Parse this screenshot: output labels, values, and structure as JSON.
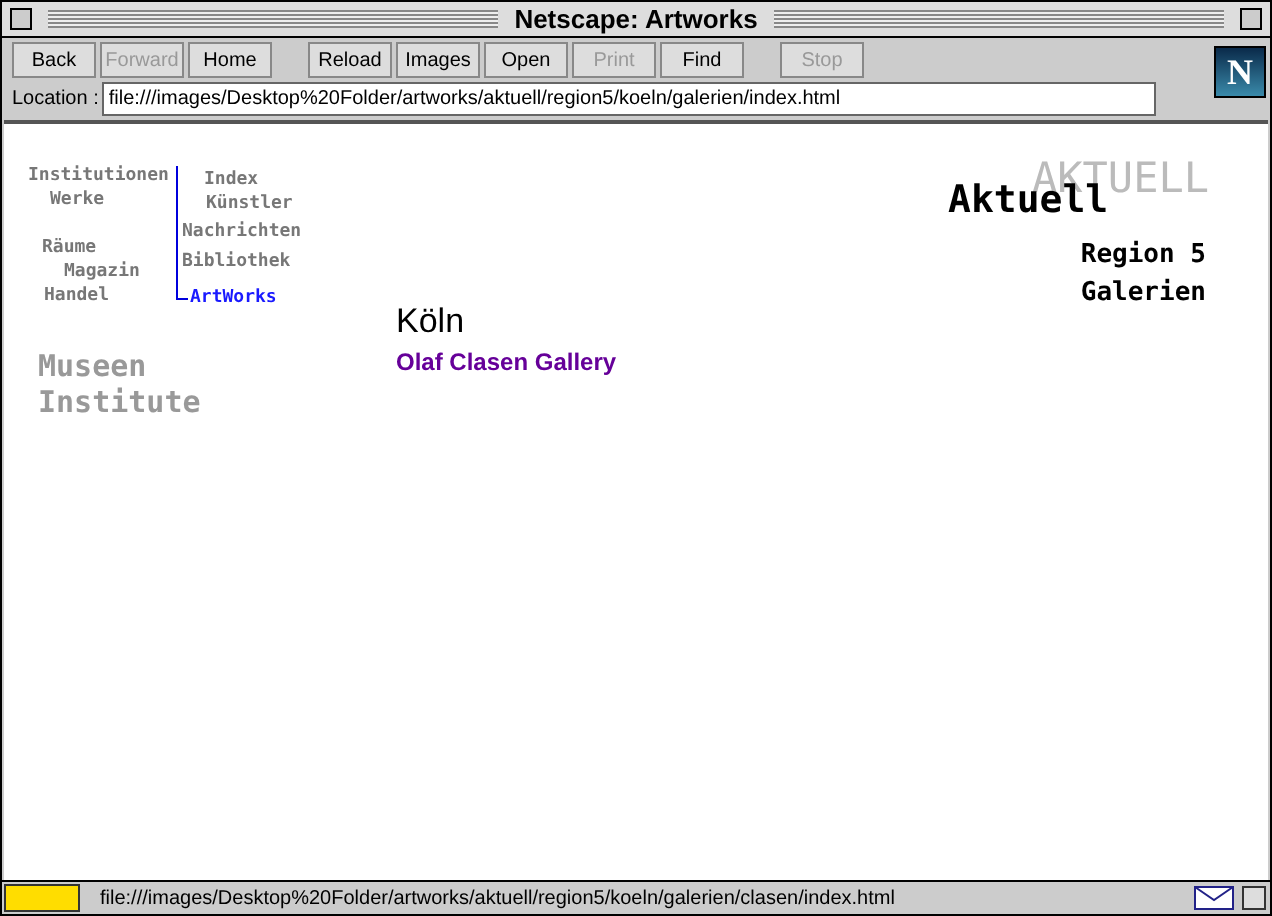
{
  "window": {
    "title": "Netscape: Artworks"
  },
  "toolbar": [
    {
      "label": "Back",
      "disabled": false
    },
    {
      "label": "Forward",
      "disabled": true
    },
    {
      "label": "Home",
      "disabled": false
    },
    {
      "label": "Reload",
      "disabled": false
    },
    {
      "label": "Images",
      "disabled": false
    },
    {
      "label": "Open",
      "disabled": false
    },
    {
      "label": "Print",
      "disabled": true
    },
    {
      "label": "Find",
      "disabled": false
    },
    {
      "label": "Stop",
      "disabled": true
    }
  ],
  "logo": {
    "letter": "N"
  },
  "location": {
    "label": "Location :",
    "value": "file:///images/Desktop%20Folder/artworks/aktuell/region5/koeln/galerien/index.html"
  },
  "page": {
    "nav_left": [
      "Institutionen",
      "Werke",
      "Räume",
      "Magazin",
      "Handel"
    ],
    "nav_right": [
      {
        "label": "Index",
        "selected": false
      },
      {
        "label": "Künstler",
        "selected": false
      },
      {
        "label": "Nachrichten",
        "selected": false
      },
      {
        "label": "Bibliothek",
        "selected": false
      },
      {
        "label": "ArtWorks",
        "selected": true
      }
    ],
    "nav_large": [
      "Museen",
      "Institute"
    ],
    "banner": "AKTUELL",
    "heading": "Aktuell",
    "subheadings": [
      "Region 5",
      "Galerien"
    ],
    "city": "Köln",
    "gallery_link": "Olaf Clasen Gallery"
  },
  "status_bar": {
    "text": "file:///images/Desktop%20Folder/artworks/aktuell/region5/koeln/galerien/clasen/index.html"
  }
}
